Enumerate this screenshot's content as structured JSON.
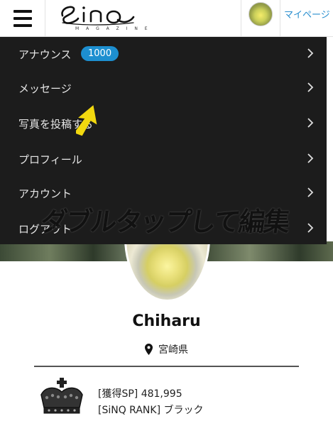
{
  "header": {
    "logo_sub": "M A G A Z I N E",
    "mypage_label": "マイページ"
  },
  "menu": {
    "items": [
      {
        "label": "アナウンス",
        "badge": "1000"
      },
      {
        "label": "メッセージ"
      },
      {
        "label": "写真を投稿する"
      },
      {
        "label": "プロフィール"
      },
      {
        "label": "アカウント"
      },
      {
        "label": "ログアウト"
      }
    ]
  },
  "overlay": {
    "watermark": "ダブルタップして編集"
  },
  "profile": {
    "name": "Chiharu",
    "location": "宮崎県",
    "points": "[獲得SP] 481,995",
    "rank": "[SiNQ RANK] ブラック"
  },
  "colors": {
    "accent": "#1d8fd0",
    "menu_bg": "#1c1c1c",
    "arrow": "#f2d80f",
    "link": "#2a8fcf"
  },
  "icons": {
    "menu": "hamburger-icon",
    "location": "location-pin-icon",
    "rank": "crown-icon",
    "chevron": "chevron-right-icon"
  }
}
